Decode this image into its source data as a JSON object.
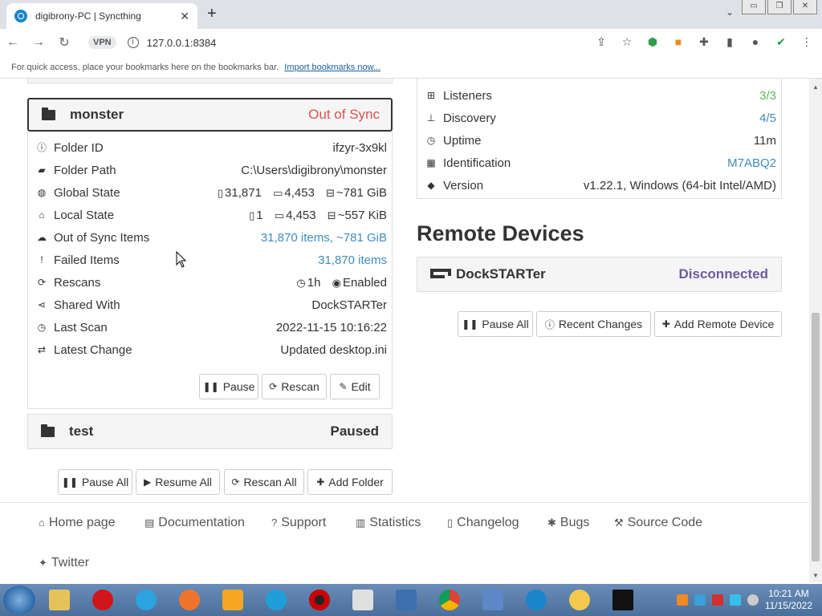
{
  "browser": {
    "tab_title": "digibrony-PC | Syncthing",
    "tab_close": "✕",
    "new_tab": "+",
    "tab_menu": "⌄",
    "window_controls": [
      "▭",
      "❐",
      "✕"
    ],
    "vpn_label": "VPN",
    "url": "127.0.0.1:8384",
    "bookmarks_text": "For quick access, place your bookmarks here on the bookmarks bar.",
    "bookmarks_link": "Import bookmarks now..."
  },
  "folder_monster": {
    "name": "monster",
    "status": "Out of Sync",
    "rows": [
      {
        "label": "Folder ID",
        "value": "ifzyr-3x9kl",
        "icon": "info-icon"
      },
      {
        "label": "Folder Path",
        "value": "C:\\Users\\digibrony\\monster",
        "icon": "folder-open-icon"
      },
      {
        "label": "Global State",
        "files": "31,871",
        "dirs": "4,453",
        "size": "~781 GiB",
        "icon": "globe-icon"
      },
      {
        "label": "Local State",
        "files": "1",
        "dirs": "4,453",
        "size": "~557 KiB",
        "icon": "home-icon"
      },
      {
        "label": "Out of Sync Items",
        "value": "31,870 items, ~781 GiB",
        "icon": "cloud-download-icon"
      },
      {
        "label": "Failed Items",
        "value": "31,870 items",
        "icon": "exclamation-icon"
      },
      {
        "label": "Rescans",
        "interval": "1h",
        "watch": "Enabled",
        "icon": "refresh-icon"
      },
      {
        "label": "Shared With",
        "value": "DockSTARTer",
        "icon": "share-icon"
      },
      {
        "label": "Last Scan",
        "value": "2022-11-15 10:16:22",
        "icon": "clock-icon"
      },
      {
        "label": "Latest Change",
        "value": "Updated desktop.ini",
        "icon": "exchange-icon"
      }
    ],
    "buttons": {
      "pause": "Pause",
      "rescan": "Rescan",
      "edit": "Edit"
    }
  },
  "folder_test": {
    "name": "test",
    "status": "Paused"
  },
  "folder_actions": {
    "pause_all": "Pause All",
    "resume_all": "Resume All",
    "rescan_all": "Rescan All",
    "add_folder": "Add Folder"
  },
  "this_device": {
    "rows": [
      {
        "label": "Listeners",
        "value": "3/3",
        "icon": "sitemap-icon"
      },
      {
        "label": "Discovery",
        "value": "4/5",
        "icon": "signpost-icon"
      },
      {
        "label": "Uptime",
        "value": "11m",
        "icon": "clock-icon"
      },
      {
        "label": "Identification",
        "value": "M7ABQ2",
        "icon": "qrcode-icon"
      },
      {
        "label": "Version",
        "value": "v1.22.1, Windows (64-bit Intel/AMD)",
        "icon": "tag-icon"
      }
    ]
  },
  "remote": {
    "title": "Remote Devices",
    "device_name": "DockSTARTer",
    "device_status": "Disconnected",
    "pause_all": "Pause All",
    "recent_changes": "Recent Changes",
    "add_remote": "Add Remote Device"
  },
  "footer": {
    "links": [
      "Home page",
      "Documentation",
      "Support",
      "Statistics",
      "Changelog",
      "Bugs",
      "Source Code",
      "Twitter"
    ]
  },
  "taskbar": {
    "time": "10:21 AM",
    "date": "11/15/2022"
  },
  "colors": {
    "out_of_sync": "#d9534f",
    "link": "#3d8dbf",
    "ok": "#5cb85c",
    "disconnected": "#6f5a9e"
  }
}
